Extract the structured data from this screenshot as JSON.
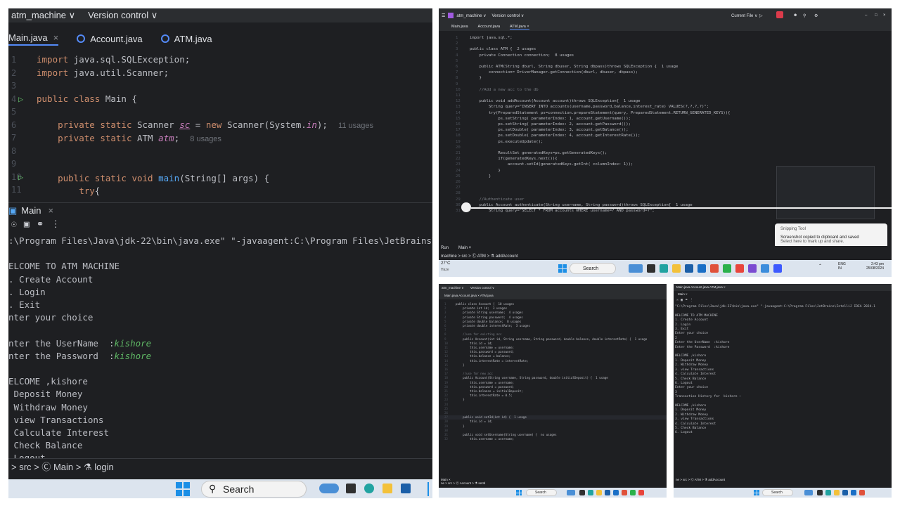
{
  "panel_a": {
    "project_menu": "atm_machine ∨",
    "vcs_menu": "Version control ∨",
    "tabs": [
      "Main.java",
      "Account.java",
      "ATM.java"
    ],
    "tab_close": "×",
    "line_numbers": [
      "1",
      "2",
      "3",
      "4",
      "5",
      "6",
      "7",
      "8",
      "9",
      "10",
      "11"
    ],
    "code": {
      "l1_kw": "import",
      "l1_rest": " java.sql.SQLException;",
      "l2_kw": "import",
      "l2_rest": " java.util.Scanner;",
      "l4_kw": "public class",
      "l4_rest": " Main {",
      "l6_kw": "private static",
      "l6_type": " Scanner ",
      "l6_var": "sc",
      "l6_mid": " = ",
      "l6_new": "new",
      "l6_call": " Scanner(System.",
      "l6_in": "in",
      "l6_end": ");",
      "l6_hint": "11 usages",
      "l7_kw": "private static",
      "l7_type": " ATM ",
      "l7_var": "atm",
      "l7_end": ";",
      "l7_hint": "8 usages",
      "l10_kw": "public static void",
      "l10_fn": "main",
      "l10_rest": "(String[] args) {",
      "l11_kw": "try",
      "l11_rest": "{"
    },
    "run_tab": "Main",
    "run_close": "×",
    "console_cmd": ":\\Program Files\\Java\\jdk-22\\bin\\java.exe\" \"-javaagent:C:\\Program Files\\JetBrains\\IntelliJ IDE",
    "console_lines": [
      "ELCOME TO ATM MACHINE",
      ". Create Account",
      ". Login",
      ". Exit",
      "nter your choice",
      "",
      "",
      "nter the UserName  :",
      "nter the Password  :",
      "",
      "ELCOME ,kishore",
      " Deposit Money",
      " Withdraw Money",
      " view Transactions",
      " Calculate Interest",
      " Check Balance",
      " Logout"
    ],
    "username_input": "kishore",
    "password_input": "kishore",
    "breadcrumb": "> src > Ⓒ Main > ⚗ login",
    "taskbar_search": "Search"
  },
  "panel_b": {
    "project_menu": "atm_machine ∨",
    "vcs_menu": "Version control ∨",
    "current_file": "Current File ∨",
    "tabs": [
      "Main.java",
      "Account.java",
      "ATM.java ×"
    ],
    "code_lines": [
      {
        "n": "1",
        "t": "import java.sql.*;"
      },
      {
        "n": "2",
        "t": ""
      },
      {
        "n": "3",
        "t": "public class ATM {  2 usages"
      },
      {
        "n": "4",
        "t": "    private Connection connection;  8 usages"
      },
      {
        "n": "5",
        "t": ""
      },
      {
        "n": "6",
        "t": "    public ATM(String dburl, String dbuser, String dbpass)throws SQLException {  1 usage"
      },
      {
        "n": "7",
        "t": "        connection= DriverManager.getConnection(dburl, dbuser, dbpass);"
      },
      {
        "n": "8",
        "t": "    }"
      },
      {
        "n": "9",
        "t": ""
      },
      {
        "n": "10",
        "t": "    //Add a new acc to the db"
      },
      {
        "n": "11",
        "t": ""
      },
      {
        "n": "12",
        "t": "    public void addAccount(Account account)throws SQLException{  1 usage"
      },
      {
        "n": "13",
        "t": "        String query=\"INSERT INTO accounts(username,password,balance,interest_rate) VALUES(?,?,?,?)\";"
      },
      {
        "n": "14",
        "t": "        try(PreparedStatement ps=connection.prepareStatement(query, PreparedStatement.RETURN_GENERATED_KEYS)){"
      },
      {
        "n": "15",
        "t": "            ps.setString( parameterIndex: 1, account.getUsername());"
      },
      {
        "n": "16",
        "t": "            ps.setString( parameterIndex: 2, account.getPassword());"
      },
      {
        "n": "17",
        "t": "            ps.setDouble( parameterIndex: 3, account.getBalance());"
      },
      {
        "n": "18",
        "t": "            ps.setDouble( parameterIndex: 4, account.getInterestRate());"
      },
      {
        "n": "19",
        "t": "            ps.executeUpdate();"
      },
      {
        "n": "20",
        "t": ""
      },
      {
        "n": "21",
        "t": "            ResultSet generatedKeys=ps.getGeneratedKeys();"
      },
      {
        "n": "22",
        "t": "            if(generatedKeys.next()){"
      },
      {
        "n": "23",
        "t": "                account.setId(generatedKeys.getInt( columnIndex: 1));"
      },
      {
        "n": "24",
        "t": "            }"
      },
      {
        "n": "25",
        "t": "        }"
      },
      {
        "n": "26",
        "t": ""
      },
      {
        "n": "27",
        "t": ""
      },
      {
        "n": "28",
        "t": ""
      },
      {
        "n": "29",
        "t": "    //Authenticate user"
      },
      {
        "n": "30",
        "t": "    public Account authenticate(String username, String password)throws SQLException{  1 usage"
      },
      {
        "n": "31",
        "t": "        String query=\"SELECT * FROM accounts WHERE username=? AND password=?\";"
      }
    ],
    "run_label": "Run",
    "run_tab": "Main ×",
    "breadcrumb": "machine > src > Ⓒ ATM > ⚗ addAccount",
    "weather_temp": "27°C",
    "weather_desc": "Haze",
    "taskbar_search": "Search",
    "tray_lang": "ENG",
    "tray_region": "IN",
    "clock_time": "2:43 pm",
    "clock_date": "25/08/2024",
    "snip_title": "Snipping Tool",
    "snip_msg": "Screenshot copied to clipboard and saved",
    "snip_sub": "Select here to mark up and share."
  },
  "panel_c": {
    "project_menu": "atm_machine ∨",
    "vcs_menu": "Version control ∨",
    "tabs": "Main.java    Account.java ×    ATM.java",
    "code_lines": [
      "public class Account {  10 usages",
      "    private int id;  3 usages",
      "    private String username;  4 usages",
      "    private String password;  4 usages",
      "    private double balance;  8 usages",
      "    private double interestRate;  3 usages",
      "",
      "    //use for existing acc",
      "    public Account(int id, String username, String password, double balance, double interestRate) {  1 usage",
      "        this.id = id;",
      "        this.username = username;",
      "        this.password = password;",
      "        this.balance = balance;",
      "        this.interestRate = interestRate;",
      "    }",
      "",
      "    //use for new acc",
      "    public Account(String username, String password, double initialDeposit) {  1 usage",
      "        this.username = username;",
      "        this.password = password;",
      "        this.balance = initialDeposit;",
      "        this.interestRate = 0.5;",
      "    }",
      "",
      "",
      "",
      "    public void setId(int id) {  1 usage",
      "        this.id = id;",
      "    }",
      "",
      "    public void setUsername(String username) {  no usages",
      "        this.username = username;"
    ],
    "run_tab": "Main ×",
    "breadcrumb": "ne > src > Ⓒ Account > ⚗ setId",
    "taskbar_search": "Search"
  },
  "panel_d": {
    "tabs": "Main.java    Account.java    ATM.java ×",
    "run_tab": "Main ×",
    "console_lines": [
      "\"C:\\Program Files\\Java\\jdk-22\\bin\\java.exe\" \"-javaagent:C:\\Program Files\\JetBrains\\IntelliJ IDEA 2024.1",
      "",
      "WELCOME TO ATM MACHINE",
      "1. Create Account",
      "2. Login",
      "3. Exit",
      "Enter your choice",
      "2",
      "Enter the UserName  :kishore",
      "Enter the Password  :kishore",
      "",
      "WELCOME ,kishore",
      "1. Deposit Money",
      "2. Withdraw Money",
      "3. view Transactions",
      "4. Calculate Interest",
      "5. Check Balance",
      "6. Logout",
      "Enter your choice",
      "3",
      "Transaction History for  kishore :",
      "",
      "WELCOME ,kishore",
      "1. Deposit Money",
      "2. Withdraw Money",
      "3. view Transactions",
      "4. Calculate Interest",
      "5. Check Balance",
      "6. Logout"
    ],
    "breadcrumb": "ne > src > Ⓒ ATM > ⚗ addAccount",
    "taskbar_search": "Search"
  }
}
